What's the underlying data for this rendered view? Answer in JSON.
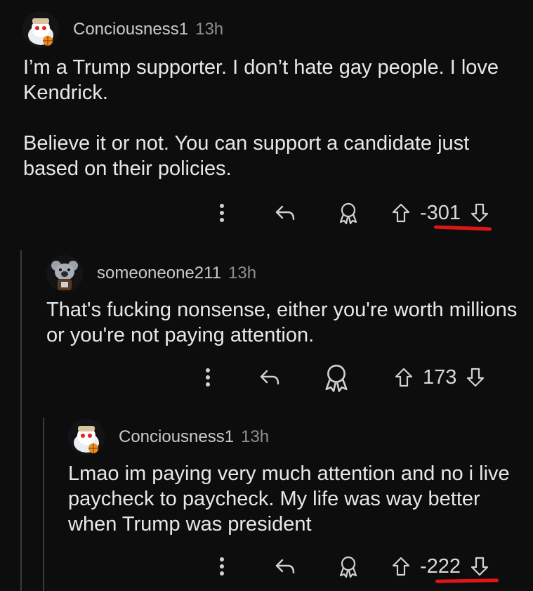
{
  "comments": [
    {
      "username": "Conciousness1",
      "time": "13h",
      "body": [
        "I’m a Trump supporter. I don’t hate gay people. I love Kendrick.",
        "Believe it or not. You can support a candidate just based on their policies."
      ],
      "score": "-301",
      "score_highlighted": true
    },
    {
      "username": "someoneone211",
      "time": "13h",
      "body": [
        "That's fucking nonsense, either you're worth millions or you're not paying attention."
      ],
      "score": "173",
      "score_highlighted": false
    },
    {
      "username": "Conciousness1",
      "time": "13h",
      "body": [
        "Lmao im paying very much attention and no i live paycheck to paycheck. My life was way better when Trump was president"
      ],
      "score": "-222",
      "score_highlighted": true
    }
  ],
  "icons": {
    "more": "more-vertical-icon",
    "reply": "reply-icon",
    "award": "award-icon",
    "upvote": "upvote-arrow-icon",
    "downvote": "downvote-arrow-icon"
  },
  "colors": {
    "background": "#0d0d0d",
    "text": "#d7dadc",
    "highlight": "#e01616"
  }
}
